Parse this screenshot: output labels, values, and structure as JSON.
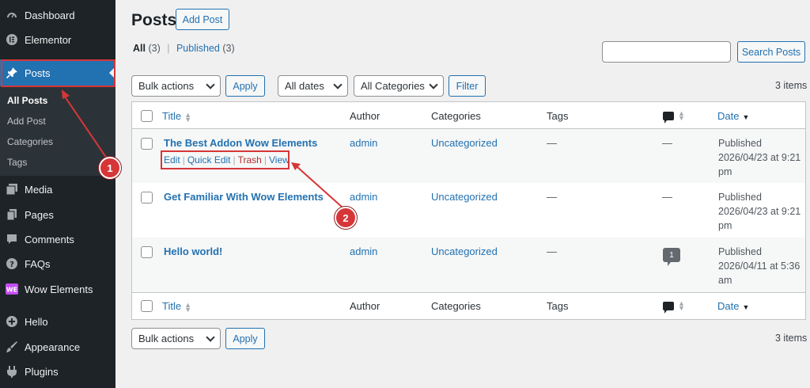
{
  "sidebar": {
    "items": [
      {
        "label": "Dashboard",
        "icon": "dashboard-icon"
      },
      {
        "label": "Elementor",
        "icon": "elementor-icon"
      },
      {
        "label": "Posts",
        "icon": "pin-icon"
      },
      {
        "label": "Media",
        "icon": "media-icon"
      },
      {
        "label": "Pages",
        "icon": "pages-icon"
      },
      {
        "label": "Comments",
        "icon": "comment-icon"
      },
      {
        "label": "FAQs",
        "icon": "question-icon"
      },
      {
        "label": "Wow Elements",
        "icon": "wow-elements-icon"
      },
      {
        "label": "Hello",
        "icon": "plus-circle-icon"
      },
      {
        "label": "Appearance",
        "icon": "brush-icon"
      },
      {
        "label": "Plugins",
        "icon": "plug-icon"
      }
    ],
    "submenu": [
      "All Posts",
      "Add Post",
      "Categories",
      "Tags"
    ]
  },
  "header": {
    "title": "Posts",
    "add_button": "Add Post"
  },
  "filters": {
    "all_label": "All",
    "all_count": "(3)",
    "published_label": "Published",
    "published_count": "(3)",
    "search_button": "Search Posts",
    "search_value": "",
    "bulk_actions": "Bulk actions",
    "apply": "Apply",
    "dates": "All dates",
    "categories": "All Categories",
    "filter": "Filter",
    "items_count": "3 items"
  },
  "table": {
    "columns": {
      "title": "Title",
      "author": "Author",
      "categories": "Categories",
      "tags": "Tags",
      "date": "Date"
    },
    "rows": [
      {
        "title": "The Best Addon Wow Elements",
        "author": "admin",
        "category": "Uncategorized",
        "tags": "—",
        "comments": "—",
        "status": "Published",
        "date": "2026/04/23 at 9:21",
        "time_suffix": "pm"
      },
      {
        "title": "Get Familiar With Wow Elements",
        "author": "admin",
        "category": "Uncategorized",
        "tags": "—",
        "comments": "—",
        "status": "Published",
        "date": "2026/04/23 at 9:21",
        "time_suffix": "pm"
      },
      {
        "title": "Hello world!",
        "author": "admin",
        "category": "Uncategorized",
        "tags": "—",
        "comments": "1",
        "status": "Published",
        "date": "2026/04/11 at 5:36",
        "time_suffix": "am"
      }
    ],
    "row_actions": {
      "edit": "Edit",
      "quick_edit": "Quick Edit",
      "trash": "Trash",
      "view": "View"
    }
  },
  "annotations": {
    "badge1": "1",
    "badge2": "2"
  },
  "colors": {
    "accent": "#2271b1",
    "sidebar": "#1d2327",
    "annotation": "#d63638"
  }
}
